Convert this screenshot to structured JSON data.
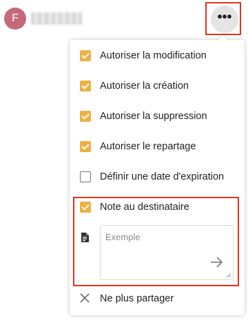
{
  "header": {
    "avatar_initial": "F",
    "more_button_label": "•••"
  },
  "menu": {
    "options": [
      {
        "label": "Autoriser la modification",
        "checked": true
      },
      {
        "label": "Autoriser la création",
        "checked": true
      },
      {
        "label": "Autoriser la suppression",
        "checked": true
      },
      {
        "label": "Autoriser le repartage",
        "checked": true
      },
      {
        "label": "Définir une date d'expiration",
        "checked": false
      },
      {
        "label": "Note au destinataire",
        "checked": true
      }
    ],
    "note": {
      "placeholder": "Exemple",
      "value": "",
      "icon": "note-icon",
      "submit_icon": "arrow-right-icon"
    },
    "unshare": {
      "label": "Ne plus partager",
      "icon": "close-icon"
    }
  },
  "colors": {
    "checkbox_accent": "#efb043",
    "avatar_bg": "#c46a7b",
    "highlight": "#e8301a"
  }
}
